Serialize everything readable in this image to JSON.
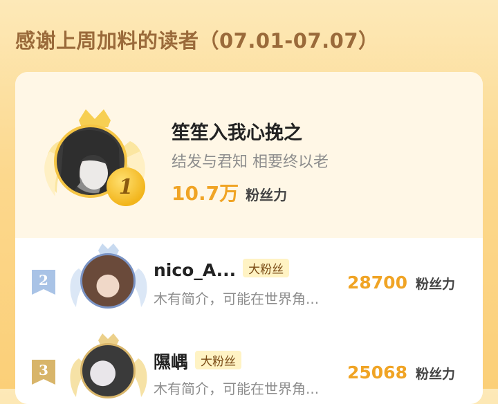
{
  "header": {
    "title": "感谢上周加料的读者（07.01-07.07）"
  },
  "top_reader": {
    "rank": "1",
    "name": "笙笙入我心挽之",
    "bio": "结发与君知 相要终以老",
    "fans_value": "10.7万",
    "fans_label": "粉丝力"
  },
  "readers": [
    {
      "rank": "2",
      "name": "nico_A...",
      "tag": "大粉丝",
      "bio": "木有简介，可能在世界角...",
      "fans_value": "28700",
      "fans_label": "粉丝力"
    },
    {
      "rank": "3",
      "name": "隰嵎",
      "tag": "大粉丝",
      "bio": "木有简介，可能在世界角...",
      "fans_value": "25068",
      "fans_label": "粉丝力"
    }
  ],
  "colors": {
    "accent": "#f0a425",
    "gold": "#f5c544",
    "silver": "#a9c3e6",
    "bronze": "#d8b56a"
  }
}
